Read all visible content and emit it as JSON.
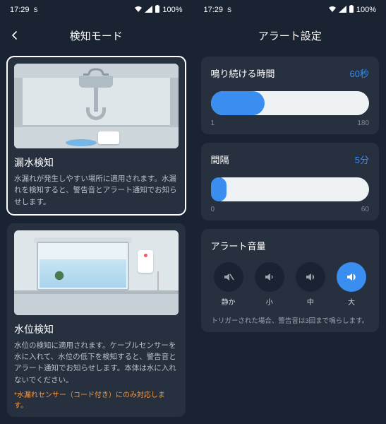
{
  "status": {
    "time": "17:29",
    "indicator": "S",
    "battery": "100%"
  },
  "left": {
    "header_title": "検知モード",
    "card1": {
      "title": "漏水検知",
      "desc": "水漏れが発生しやすい場所に適用されます。水漏れを検知すると、警告音とアラート通知でお知らせします。"
    },
    "card2": {
      "title": "水位検知",
      "desc": "水位の検知に適用されます。ケーブルセンサーを水に入れて、水位の低下を検知すると、警告音とアラート通知でお知らせします。本体は水に入れないでください。",
      "note": "*水漏れセンサー（コード付き）にのみ対応します。"
    }
  },
  "right": {
    "header_title": "アラート設定",
    "duration": {
      "label": "鳴り続ける時間",
      "value": "60秒",
      "min": "1",
      "max": "180"
    },
    "interval": {
      "label": "間隔",
      "value": "5分",
      "min": "0",
      "max": "60"
    },
    "volume": {
      "title": "アラート音量",
      "opts": {
        "mute": "静か",
        "low": "小",
        "mid": "中",
        "high": "大"
      },
      "note": "トリガーされた場合、警告音は3回まで鳴らします。"
    }
  }
}
